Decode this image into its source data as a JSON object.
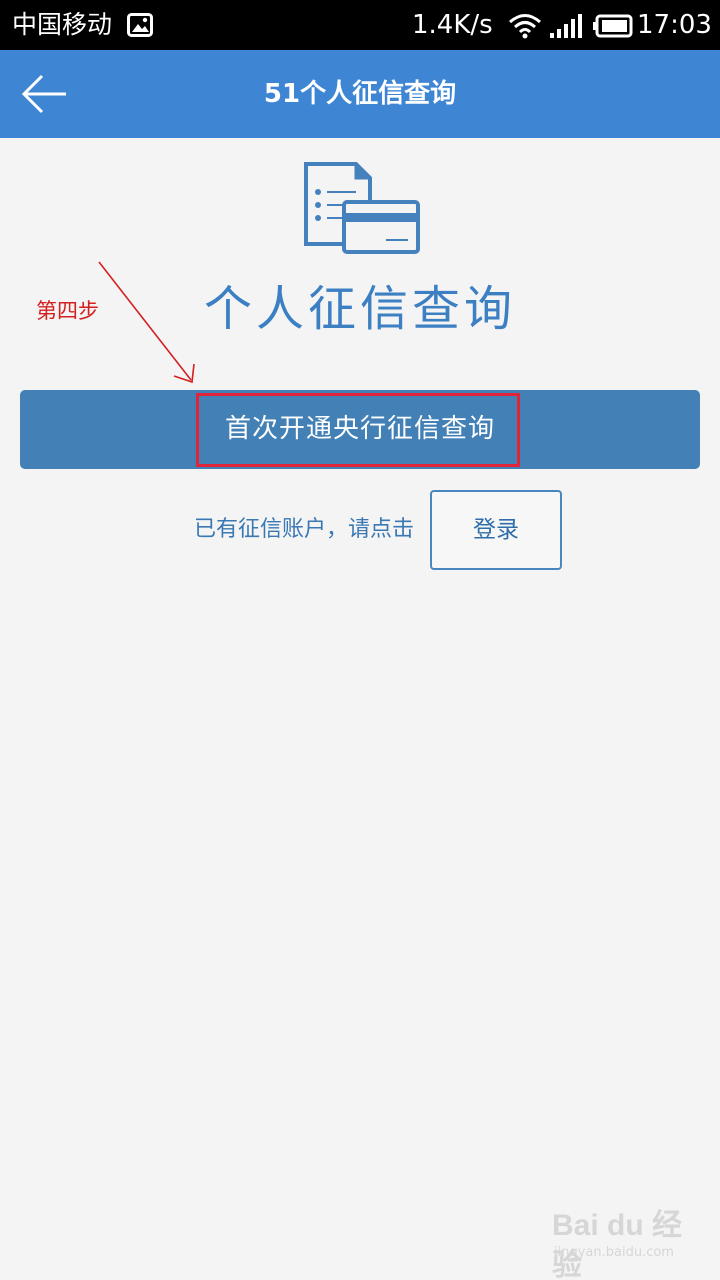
{
  "status_bar": {
    "carrier": "中国移动",
    "net_speed": "1.4K/s",
    "time": "17:03",
    "icons": [
      "gallery-notification-icon",
      "wifi-icon",
      "signal-icon",
      "battery-icon"
    ]
  },
  "app_bar": {
    "title": "51个人征信查询",
    "back_icon": "arrow-left-icon",
    "background": "#3e86d4"
  },
  "main": {
    "icon": "credit-report-card-icon",
    "heading": "个人征信查询",
    "primary_button": "首次开通央行征信查询",
    "login_hint": "已有征信账户，请点击",
    "login_button": "登录"
  },
  "annotation": {
    "step_label": "第四步",
    "color": "#d42020"
  },
  "watermark": {
    "brand": "Bai du 经验",
    "url": "jingyan.baidu.com"
  },
  "colors": {
    "accent": "#3e86d4",
    "button": "#4280b6",
    "heading": "#3c7fc2",
    "highlight": "#e0253a"
  }
}
